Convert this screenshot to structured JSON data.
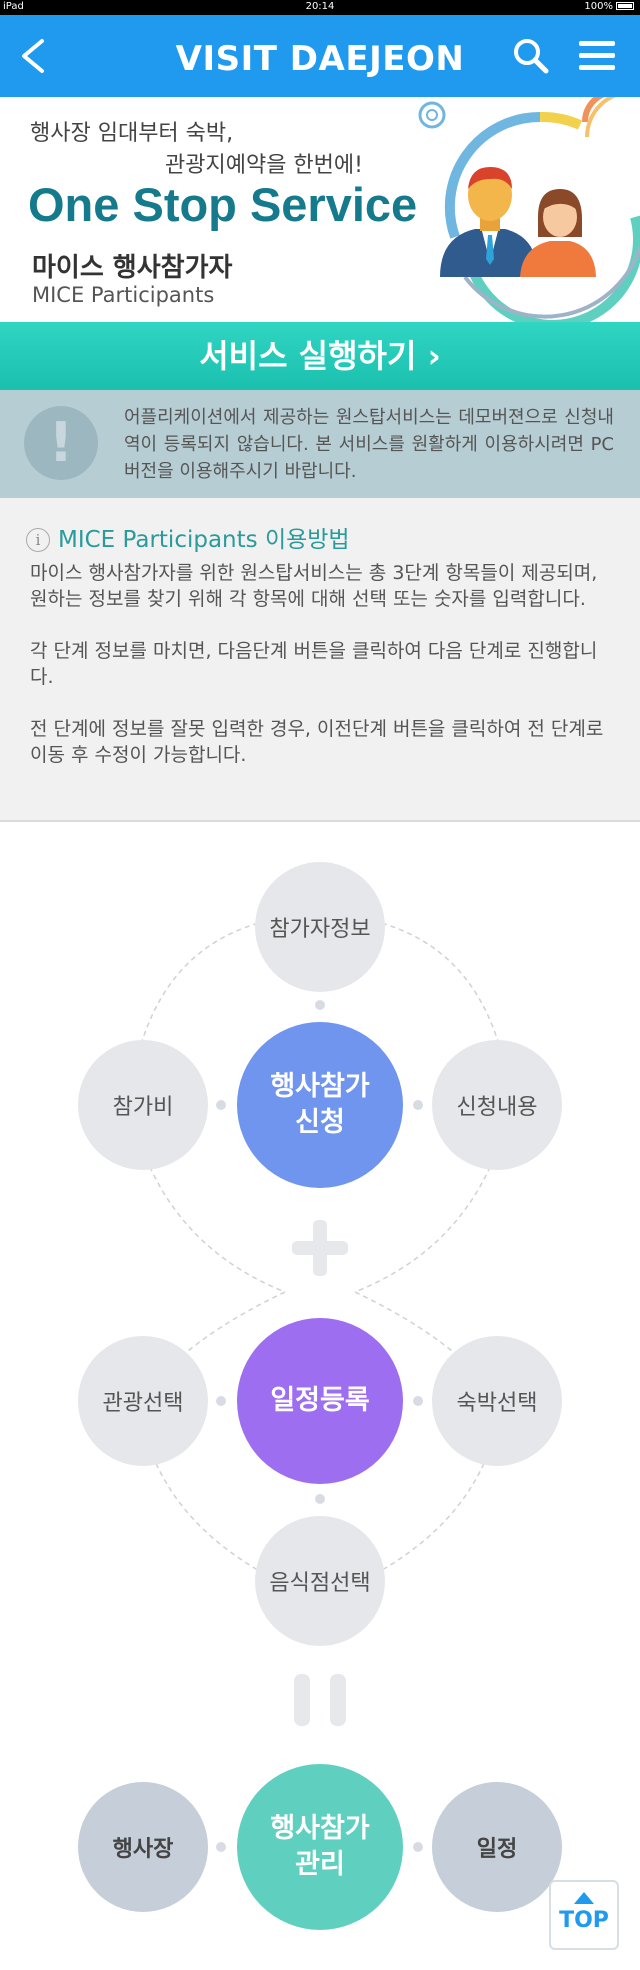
{
  "status_bar": {
    "device": "iPad",
    "time": "20:14",
    "battery": "100%"
  },
  "header": {
    "title": "VISIT DAEJEON"
  },
  "banner": {
    "tagline_line1": "행사장 임대부터 숙박,",
    "tagline_line2": "관광지예약을 한번에!",
    "heading": "One Stop Service",
    "subtitle_ko": "마이스 행사참가자",
    "subtitle_en": "MICE Participants"
  },
  "service_button": {
    "label": "서비스 실행하기 ›"
  },
  "notice": {
    "icon": "exclamation-icon",
    "text": "어플리케이션에서 제공하는 원스탑서비스는 데모버젼으로 신청내역이 등록되지 않습니다. 본 서비스를 원활하게 이용하시려면 PC버전을 이용해주시기 바랍니다."
  },
  "usage": {
    "title": "MICE Participants 이용방법",
    "paragraphs": [
      "마이스 행사참가자를 위한 원스탑서비스는 총 3단계 항목들이 제공되며, 원하는 정보를 찾기 위해 각 항목에 대해 선택 또는 숫자를 입력합니다.",
      "각 단계 정보를 마치면, 다음단계 버튼을 클릭하여 다음 단계로 진행합니다.",
      "전 단계에 정보를 잘못 입력한 경우, 이전단계 버튼을 클릭하여 전 단계로 이동 후 수정이 가능합니다."
    ]
  },
  "diagram": {
    "step1": {
      "center": "행사참가\n신청",
      "top": "참가자정보",
      "left": "참가비",
      "right": "신청내용"
    },
    "step2": {
      "center": "일정등록",
      "left": "관광선택",
      "right": "숙박선택",
      "bottom": "음식점선택"
    },
    "step3": {
      "center": "행사참가\n관리",
      "left": "행사장",
      "right": "일정"
    },
    "colors": {
      "step1": "#6f95ee",
      "step2": "#9d6ff0",
      "step3": "#5fd0c0"
    }
  },
  "top_button": {
    "label": "TOP"
  }
}
